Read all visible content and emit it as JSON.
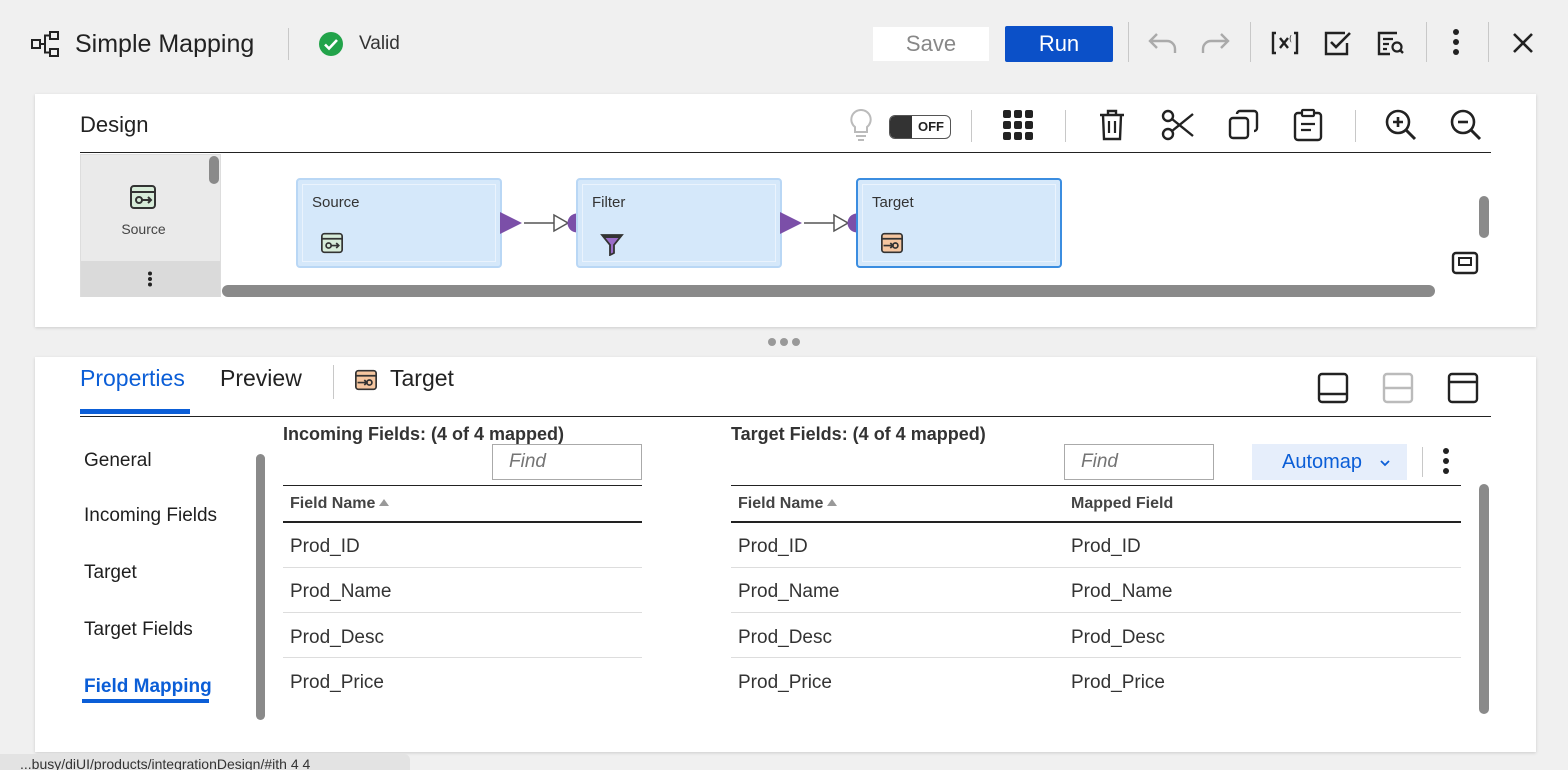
{
  "header": {
    "title": "Simple Mapping",
    "status": "Valid",
    "save_label": "Save",
    "run_label": "Run",
    "icons": [
      "mapping-icon",
      "valid-check-icon",
      "undo-icon",
      "redo-icon",
      "parameter-icon",
      "validate-icon",
      "summary-icon",
      "more-vertical-icon",
      "close-icon"
    ]
  },
  "design": {
    "title": "Design",
    "toggle_label": "OFF",
    "palette_label": "Source",
    "nodes": [
      {
        "title": "Source",
        "icon": "source-icon"
      },
      {
        "title": "Filter",
        "icon": "filter-icon"
      },
      {
        "title": "Target",
        "icon": "target-icon"
      }
    ],
    "toolbar_icons": [
      "lightbulb-icon",
      "grid-icon",
      "trash-icon",
      "cut-icon",
      "copy-icon",
      "paste-icon",
      "zoom-in-icon",
      "zoom-out-icon",
      "fit-icon"
    ]
  },
  "properties": {
    "tabs": [
      "Properties",
      "Preview"
    ],
    "object_label": "Target",
    "side_items": [
      "General",
      "Incoming Fields",
      "Target",
      "Target Fields",
      "Field Mapping"
    ],
    "active_side_item": "Field Mapping",
    "incoming": {
      "title": "Incoming Fields: (4 of 4 mapped)",
      "find_placeholder": "Find",
      "column": "Field Name",
      "rows": [
        "Prod_ID",
        "Prod_Name",
        "Prod_Desc",
        "Prod_Price"
      ]
    },
    "target": {
      "title": "Target Fields: (4 of 4 mapped)",
      "find_placeholder": "Find",
      "automap_label": "Automap",
      "columns": [
        "Field Name",
        "Mapped Field"
      ],
      "rows": [
        {
          "field": "Prod_ID",
          "mapped": "Prod_ID"
        },
        {
          "field": "Prod_Name",
          "mapped": "Prod_Name"
        },
        {
          "field": "Prod_Desc",
          "mapped": "Prod_Desc"
        },
        {
          "field": "Prod_Price",
          "mapped": "Prod_Price"
        }
      ]
    }
  },
  "statusbar": {
    "text": "...busy/diUI/products/integrationDesign/#ith 4 4"
  },
  "colors": {
    "accent": "#0b5ed7",
    "run_button": "#0b50c8",
    "node_fill": "#d5e8fa",
    "port": "#7b4fa8",
    "valid": "#22a34a"
  }
}
